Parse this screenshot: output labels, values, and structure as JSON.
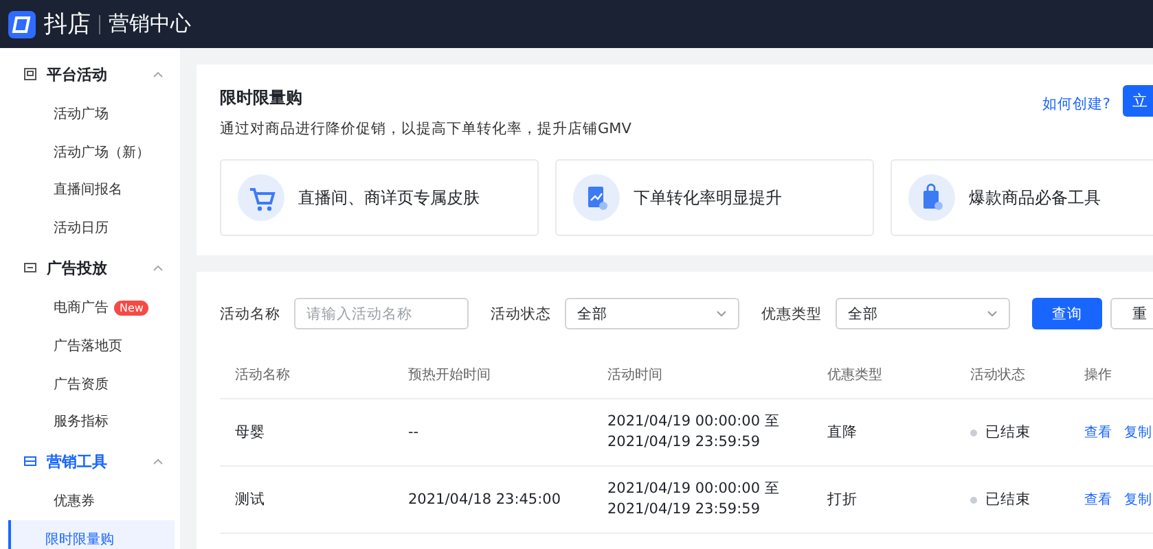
{
  "header": {
    "logo_text": "抖店",
    "section": "营销中心"
  },
  "sidebar": {
    "groups": [
      {
        "label": "平台活动",
        "active": false,
        "expanded": true,
        "items": [
          {
            "label": "活动广场",
            "selected": false
          },
          {
            "label": "活动广场（新）",
            "selected": false
          },
          {
            "label": "直播间报名",
            "selected": false
          },
          {
            "label": "活动日历",
            "selected": false
          }
        ]
      },
      {
        "label": "广告投放",
        "active": false,
        "expanded": true,
        "items": [
          {
            "label": "电商广告",
            "badge": "New",
            "selected": false
          },
          {
            "label": "广告落地页",
            "selected": false
          },
          {
            "label": "广告资质",
            "selected": false
          },
          {
            "label": "服务指标",
            "selected": false
          }
        ]
      },
      {
        "label": "营销工具",
        "active": true,
        "expanded": true,
        "items": [
          {
            "label": "优惠券",
            "selected": false
          },
          {
            "label": "限时限量购",
            "selected": true
          }
        ]
      }
    ]
  },
  "intro": {
    "title": "限时限量购",
    "description": "通过对商品进行降价促销，以提高下单转化率，提升店铺GMV",
    "help_link": "如何创建?",
    "create_button": "立"
  },
  "features": [
    {
      "kind": "cart",
      "label": "直播间、商详页专属皮肤"
    },
    {
      "kind": "chart",
      "label": "下单转化率明显提升"
    },
    {
      "kind": "bag",
      "label": "爆款商品必备工具"
    }
  ],
  "filters": [
    {
      "kind": "input",
      "label": "活动名称",
      "placeholder": "请输入活动名称"
    },
    {
      "kind": "select",
      "label": "活动状态",
      "value": "全部"
    },
    {
      "kind": "select",
      "label": "优惠类型",
      "value": "全部"
    }
  ],
  "filter_buttons": [
    {
      "kind": "primary",
      "label": "查询"
    },
    {
      "kind": "default",
      "label": "重"
    }
  ],
  "table": {
    "columns": [
      "活动名称",
      "预热开始时间",
      "活动时间",
      "优惠类型",
      "活动状态",
      "操作"
    ],
    "rows": [
      {
        "name": "母婴",
        "preheat": "--",
        "time_start": "2021/04/19 00:00:00 至",
        "time_end": "2021/04/19 23:59:59",
        "type": "直降",
        "status": "已结束",
        "color": "#c9cdd4",
        "actions": [
          "查看",
          "复制"
        ]
      },
      {
        "name": "测试",
        "preheat": "2021/04/18 23:45:00",
        "time_start": "2021/04/19 00:00:00 至",
        "time_end": "2021/04/19 23:59:59",
        "type": "打折",
        "status": "已结束",
        "color": "#c9cdd4",
        "actions": [
          "查看",
          "复制"
        ]
      }
    ]
  }
}
